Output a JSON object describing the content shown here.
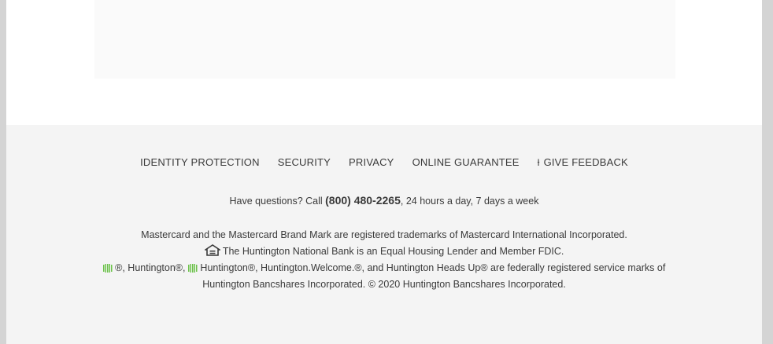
{
  "footer_nav": [
    {
      "label": "IDENTITY PROTECTION"
    },
    {
      "label": "SECURITY"
    },
    {
      "label": "PRIVACY"
    },
    {
      "label": "ONLINE GUARANTEE"
    },
    {
      "label": "GIVE FEEDBACK",
      "icon": "feedback-icon"
    }
  ],
  "contact": {
    "prefix": "Have questions? Call ",
    "phone": "(800) 480-2265",
    "suffix": ", 24 hours a day, 7 days a week"
  },
  "legal": {
    "mastercard": "Mastercard and the Mastercard Brand Mark are registered trademarks of Mastercard International Incorporated.",
    "equal_housing": "The Huntington National Bank is an Equal Housing Lender and Member FDIC.",
    "marks_part1": "®, Huntington®, ",
    "marks_part2": "Huntington®, Huntington.Welcome.®, and Huntington Heads Up® are federally registered service marks of",
    "marks_line2": "Huntington Bancshares Incorporated. © 2020 Huntington Bancshares Incorporated."
  },
  "colors": {
    "brand_green": "#6cc24a",
    "footer_bg": "#f4f4f4",
    "text": "#3a3a3a"
  },
  "icons": [
    "feedback-icon",
    "equal-housing-icon",
    "huntington-logo-icon"
  ]
}
